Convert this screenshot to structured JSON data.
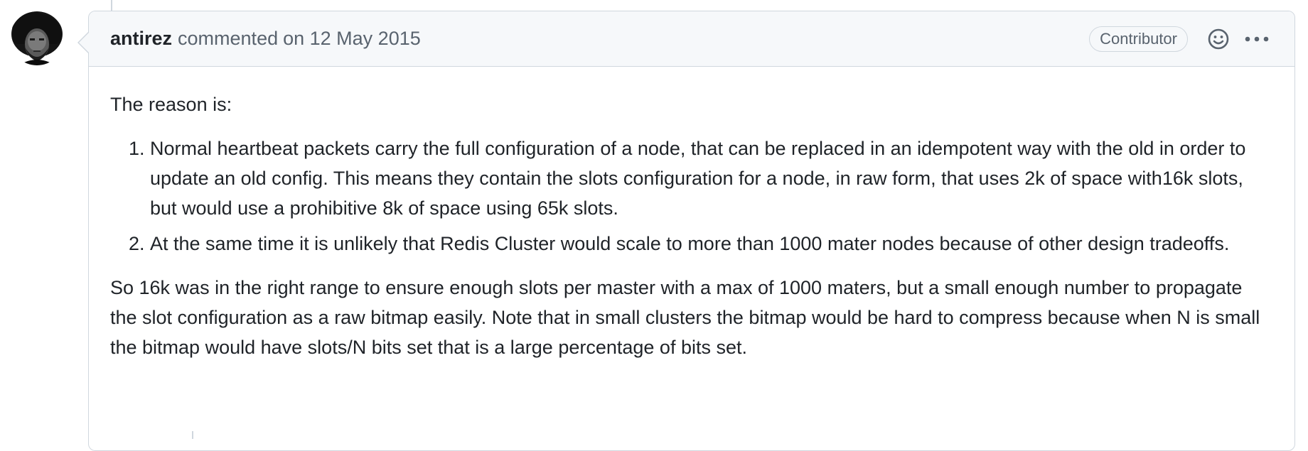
{
  "comment": {
    "author": "antirez",
    "action": "commented",
    "date": "on 12 May 2015",
    "badge": "Contributor",
    "icons": {
      "reaction": "smiley-icon",
      "menu": "kebab-horizontal-icon"
    },
    "body": {
      "intro": "The reason is:",
      "list_items": [
        "Normal heartbeat packets carry the full configuration of a node, that can be replaced in an idempotent way with the old in order to update an old config. This means they contain the slots configuration for a node, in raw form, that uses 2k of space with16k slots, but would use a prohibitive 8k of space using 65k slots.",
        "At the same time it is unlikely that Redis Cluster would scale to more than 1000 mater nodes because of other design tradeoffs."
      ],
      "conclusion": "So 16k was in the right range to ensure enough slots per master with a max of 1000 maters, but a small enough number to propagate the slot configuration as a raw bitmap easily. Note that in small clusters the bitmap would be hard to compress because when N is small the bitmap would have slots/N bits set that is a large percentage of bits set."
    }
  },
  "colors": {
    "header_bg": "#f6f8fa",
    "border": "#d0d7de",
    "muted_text": "#59636e",
    "text": "#1f2328"
  }
}
